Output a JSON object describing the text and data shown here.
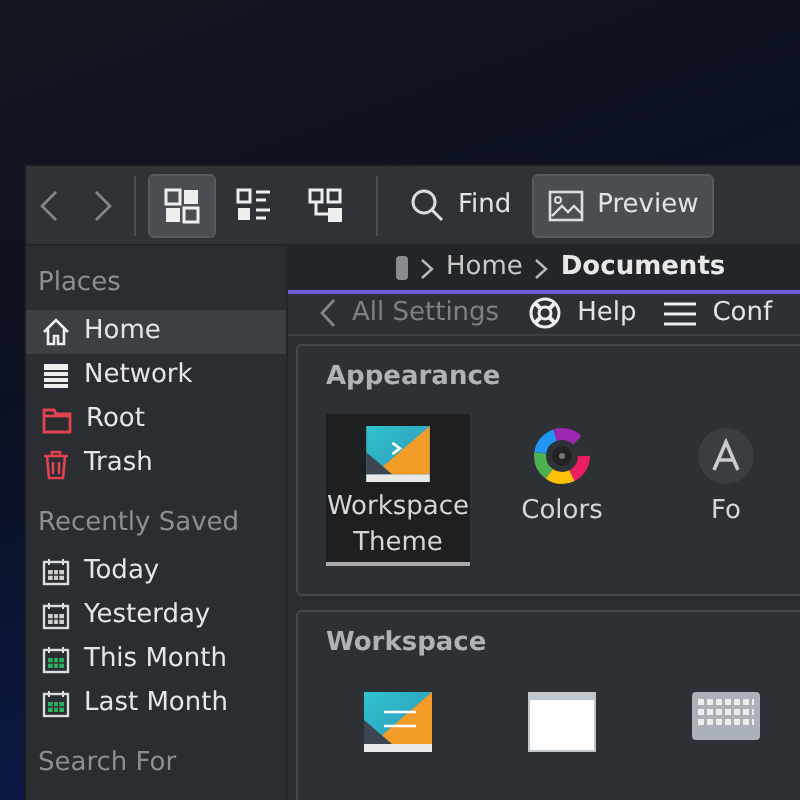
{
  "toolbar": {
    "views": [
      {
        "kind": "icons",
        "selected": true
      },
      {
        "kind": "details",
        "selected": false
      },
      {
        "kind": "tree",
        "selected": false
      }
    ],
    "actions": [
      {
        "kind": "find",
        "label": "Find",
        "selected": false
      },
      {
        "kind": "preview",
        "label": "Preview",
        "selected": true
      }
    ]
  },
  "sidebar": {
    "sections": [
      {
        "title": "Places",
        "items": [
          {
            "label": "Home",
            "kind": "home",
            "selected": true
          },
          {
            "label": "Network",
            "kind": "network",
            "selected": false
          },
          {
            "label": "Root",
            "kind": "root",
            "selected": false
          },
          {
            "label": "Trash",
            "kind": "trash",
            "selected": false
          }
        ]
      },
      {
        "title": "Recently Saved",
        "items": [
          {
            "label": "Today",
            "kind": "calendar",
            "selected": false
          },
          {
            "label": "Yesterday",
            "kind": "calendar",
            "selected": false
          },
          {
            "label": "This Month",
            "kind": "month",
            "selected": false
          },
          {
            "label": "Last Month",
            "kind": "month",
            "selected": false
          }
        ]
      },
      {
        "title": "Search For"
      }
    ]
  },
  "breadcrumb": [
    {
      "label": "Home",
      "current": false
    },
    {
      "label": "Documents",
      "current": true
    }
  ],
  "settings": {
    "back": "All Settings",
    "help": "Help",
    "configure": "Conf",
    "groups": [
      {
        "title": "Appearance",
        "items": [
          {
            "label": "Workspace Theme",
            "kind": "theme",
            "selected": true
          },
          {
            "label": "Colors",
            "kind": "colors",
            "selected": false
          },
          {
            "label": "Fo",
            "kind": "fonts",
            "selected": false
          }
        ]
      },
      {
        "title": "Workspace",
        "items": [
          {
            "kind": "desktop",
            "selected": false
          },
          {
            "kind": "window",
            "selected": false
          },
          {
            "kind": "keyboard",
            "selected": false
          }
        ]
      }
    ]
  }
}
